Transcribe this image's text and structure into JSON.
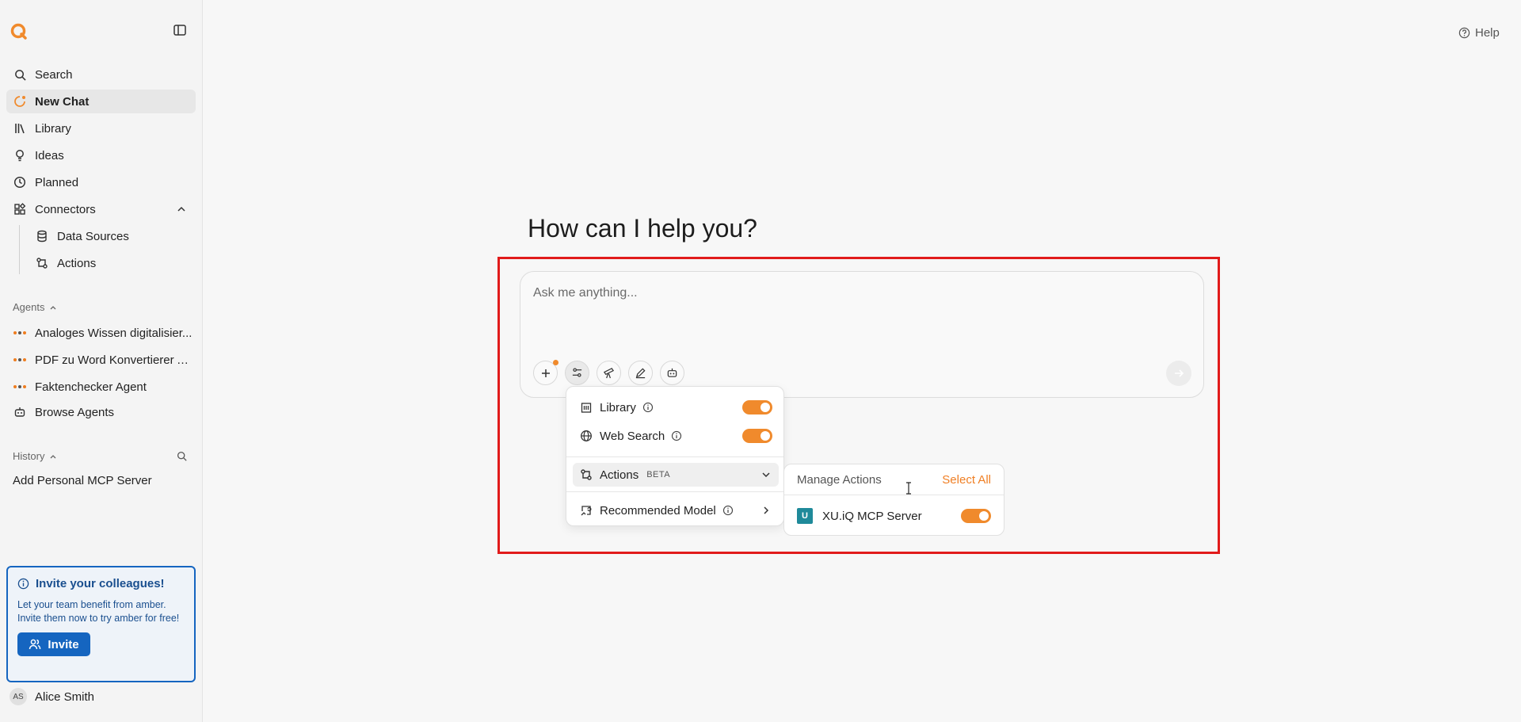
{
  "sidebar": {
    "nav": [
      {
        "label": "Search",
        "icon": "search-icon"
      },
      {
        "label": "New Chat",
        "icon": "new-chat-icon",
        "active": true
      },
      {
        "label": "Library",
        "icon": "library-icon"
      },
      {
        "label": "Ideas",
        "icon": "lightbulb-icon"
      },
      {
        "label": "Planned",
        "icon": "clock-icon"
      },
      {
        "label": "Connectors",
        "icon": "connectors-icon"
      }
    ],
    "connectors_sub": [
      {
        "label": "Data Sources",
        "icon": "database-icon"
      },
      {
        "label": "Actions",
        "icon": "actions-icon"
      }
    ],
    "agents_label": "Agents",
    "agents": [
      {
        "label": "Analoges Wissen digitalisier..."
      },
      {
        "label": "PDF zu Word Konvertierer A..."
      },
      {
        "label": "Faktenchecker Agent"
      }
    ],
    "browse_agents": "Browse Agents",
    "history_label": "History",
    "history": [
      "Add Personal MCP Server"
    ],
    "invite": {
      "title": "Invite your colleagues!",
      "text": "Let your team benefit from amber. Invite them now to try amber for free!",
      "button": "Invite"
    },
    "user": {
      "initials": "AS",
      "name": "Alice Smith"
    }
  },
  "header": {
    "help": "Help"
  },
  "main": {
    "heading": "How can I help you?",
    "composer_placeholder": "Ask me anything..."
  },
  "dropdown": {
    "library": "Library",
    "web_search": "Web Search",
    "actions": "Actions",
    "actions_badge": "BETA",
    "recommended_model": "Recommended Model"
  },
  "actions_panel": {
    "title": "Manage Actions",
    "select_all": "Select All",
    "items": [
      {
        "label": "XU.iQ MCP Server",
        "logo": "U",
        "enabled": true
      }
    ]
  },
  "colors": {
    "accent": "#f08a2c",
    "invite": "#1565c0",
    "focus_frame": "#e11b1b"
  }
}
